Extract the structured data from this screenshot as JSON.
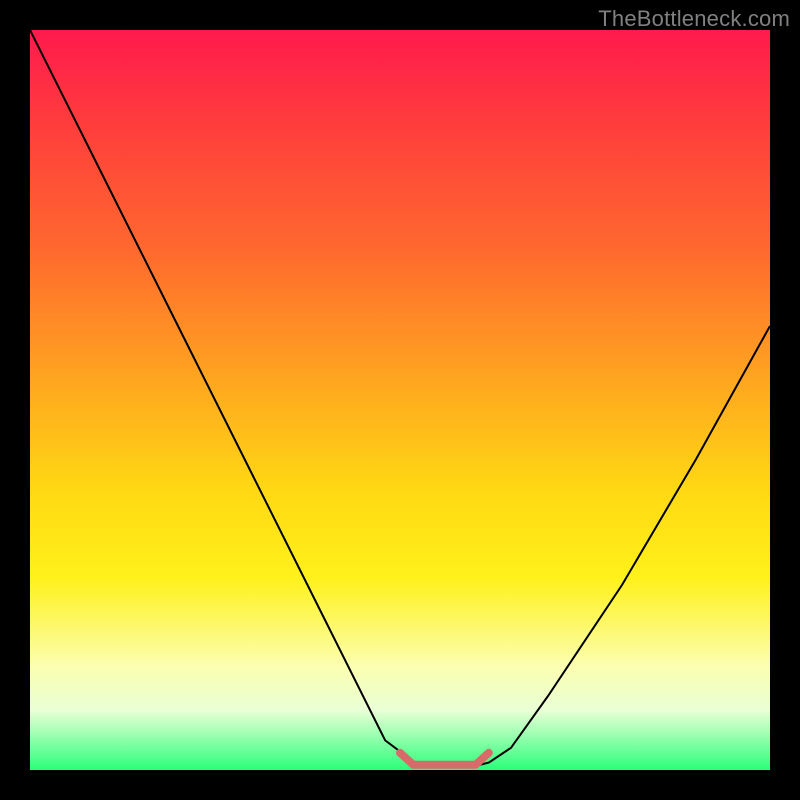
{
  "watermark": "TheBottleneck.com",
  "colors": {
    "background": "#000000",
    "curve": "#000000",
    "marker": "#d96a6a",
    "watermark": "#808080"
  },
  "chart_data": {
    "type": "line",
    "title": "",
    "xlabel": "",
    "ylabel": "",
    "xlim": [
      0,
      100
    ],
    "ylim": [
      0,
      100
    ],
    "grid": false,
    "series": [
      {
        "name": "curve",
        "x": [
          0,
          10,
          20,
          30,
          40,
          48,
          52,
          55,
          60,
          62,
          65,
          70,
          80,
          90,
          100
        ],
        "y": [
          100,
          80,
          60,
          40,
          20,
          4,
          1,
          0.5,
          0.5,
          1,
          3,
          10,
          25,
          42,
          60
        ]
      }
    ],
    "flat_region": {
      "x_start": 50,
      "x_end": 62,
      "y": 0.7
    }
  }
}
